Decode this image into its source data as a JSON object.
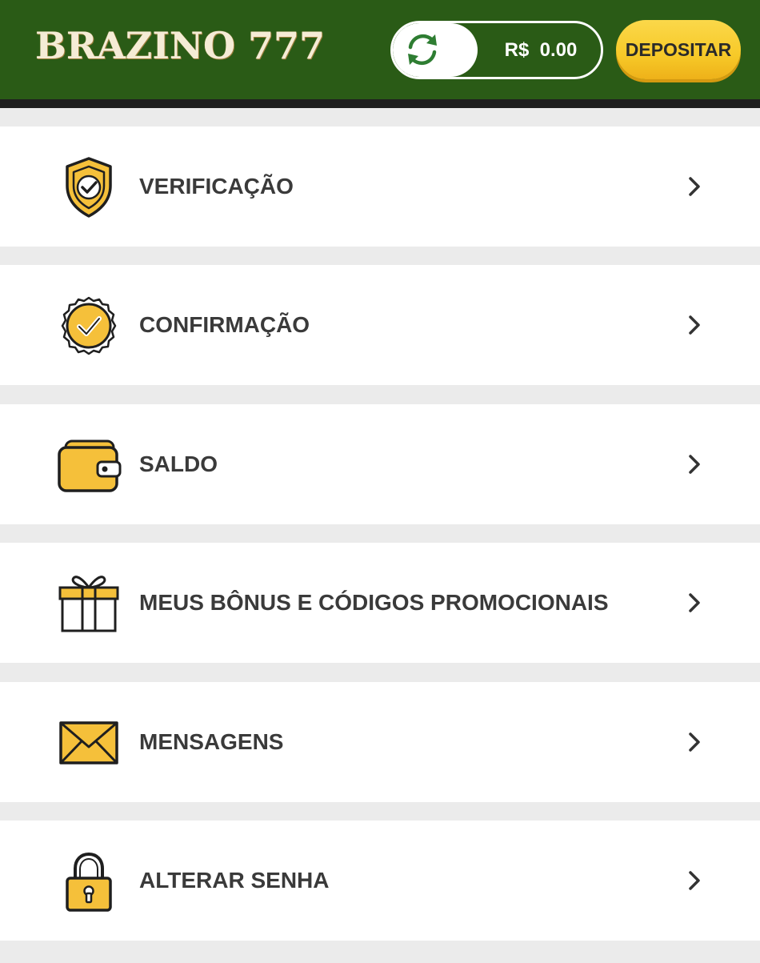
{
  "header": {
    "logo_text": "BRAZINO 777",
    "balance": "R$  0.00",
    "deposit_label": "DEPOSITAR",
    "refresh_icon": "refresh-icon",
    "colors": {
      "header_bg": "#2a5b16",
      "accent_yellow": "#f7c928"
    }
  },
  "menu": {
    "items": [
      {
        "label": "VERIFICAÇÃO",
        "icon": "shield-check-icon"
      },
      {
        "label": "CONFIRMAÇÃO",
        "icon": "badge-check-icon"
      },
      {
        "label": "SALDO",
        "icon": "wallet-icon"
      },
      {
        "label": "MEUS BÔNUS E CÓDIGOS PROMOCIONAIS",
        "icon": "gift-icon"
      },
      {
        "label": "MENSAGENS",
        "icon": "envelope-icon"
      },
      {
        "label": "ALTERAR SENHA",
        "icon": "padlock-icon"
      }
    ],
    "chevron_icon": "chevron-right-icon"
  }
}
